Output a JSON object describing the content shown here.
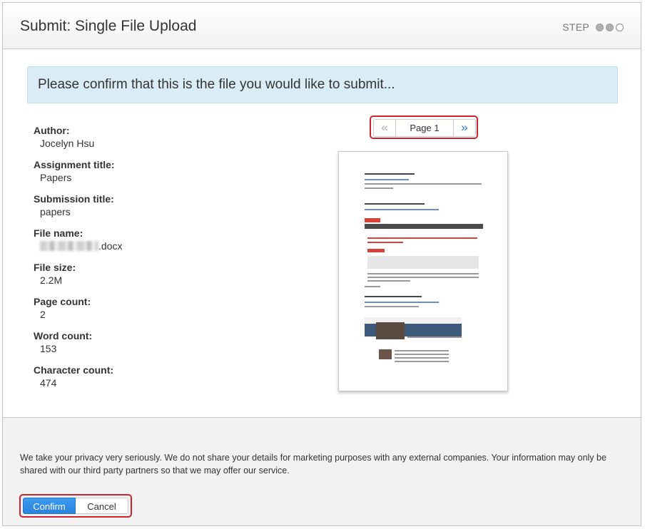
{
  "header": {
    "title": "Submit: Single File Upload",
    "step_label": "STEP",
    "step_total": 3,
    "step_completed": 2
  },
  "alert": {
    "message": "Please confirm that this is the file you would like to submit..."
  },
  "details": [
    {
      "label": "Author:",
      "value": "Jocelyn Hsu"
    },
    {
      "label": "Assignment title:",
      "value": "Papers"
    },
    {
      "label": "Submission title:",
      "value": "papers"
    },
    {
      "label": "File name:",
      "value": ".docx"
    },
    {
      "label": "File size:",
      "value": "2.2M"
    },
    {
      "label": "Page count:",
      "value": "2"
    },
    {
      "label": "Word count:",
      "value": "153"
    },
    {
      "label": "Character count:",
      "value": "474"
    }
  ],
  "pager": {
    "prev": "«",
    "label": "Page 1",
    "next": "»"
  },
  "footer": {
    "privacy": "We take your privacy very seriously. We do not share your details for marketing purposes with any external companies. Your information may only be shared with our third party partners so that we may offer our service.",
    "confirm": "Confirm",
    "cancel": "Cancel"
  },
  "colors": {
    "accent": "#2a82dd",
    "highlight_border": "#c9252f",
    "alert_bg": "#daedf6"
  }
}
